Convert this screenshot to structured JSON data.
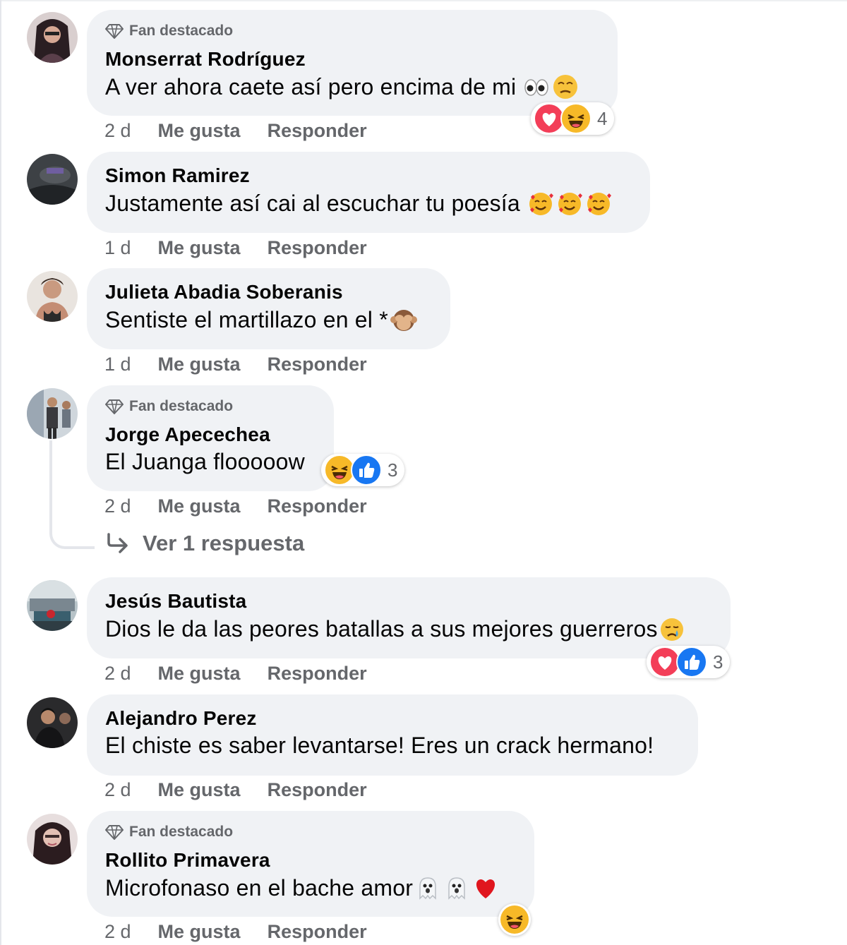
{
  "comments": [
    {
      "badge": "Fan destacado",
      "name": "Monserrat Rodríguez",
      "text": "A ver ahora caete así pero encima de mi",
      "emojis": [
        "eyes",
        "dizzy-face"
      ],
      "time": "2 d",
      "like_label": "Me gusta",
      "reply_label": "Responder",
      "reaction_icons": [
        "love",
        "haha"
      ],
      "reaction_count": "4"
    },
    {
      "name": "Simon Ramirez",
      "text": "Justamente así cai al escuchar tu poesía",
      "emojis": [
        "smiling-face-with-hearts",
        "smiling-face-with-hearts",
        "smiling-face-with-hearts"
      ],
      "time": "1 d",
      "like_label": "Me gusta",
      "reply_label": "Responder"
    },
    {
      "name": "Julieta Abadia Soberanis",
      "text": "Sentiste el martillazo en el *",
      "emojis": [
        "see-no-evil-monkey"
      ],
      "time": "1 d",
      "like_label": "Me gusta",
      "reply_label": "Responder"
    },
    {
      "badge": "Fan destacado",
      "name": "Jorge Apecechea",
      "text": "El Juanga flooooow",
      "time": "2 d",
      "like_label": "Me gusta",
      "reply_label": "Responder",
      "reaction_icons": [
        "haha",
        "like"
      ],
      "reaction_count": "3",
      "view_replies": "Ver 1 respuesta"
    },
    {
      "name": "Jesús Bautista",
      "text": "Dios le da las peores batallas a sus mejores guerreros",
      "emojis": [
        "crying-face"
      ],
      "time": "2 d",
      "like_label": "Me gusta",
      "reply_label": "Responder",
      "reaction_icons": [
        "love",
        "like"
      ],
      "reaction_count": "3"
    },
    {
      "name": "Alejandro Perez",
      "text": "El chiste es saber levantarse! Eres un crack hermano!",
      "time": "2 d",
      "like_label": "Me gusta",
      "reply_label": "Responder"
    },
    {
      "badge": "Fan destacado",
      "name": "Rollito Primavera",
      "text": "Microfonaso en el bache amor",
      "emojis": [
        "ghost",
        "ghost",
        "red-heart"
      ],
      "time": "2 d",
      "like_label": "Me gusta",
      "reply_label": "Responder",
      "reaction_icons": [
        "haha"
      ]
    }
  ],
  "colors": {
    "bubble": "#f0f2f5",
    "meta_text": "#65676b",
    "like_blue": "#1877f2",
    "love_red": "#f33e58",
    "haha_yellow": "#f7b928"
  }
}
